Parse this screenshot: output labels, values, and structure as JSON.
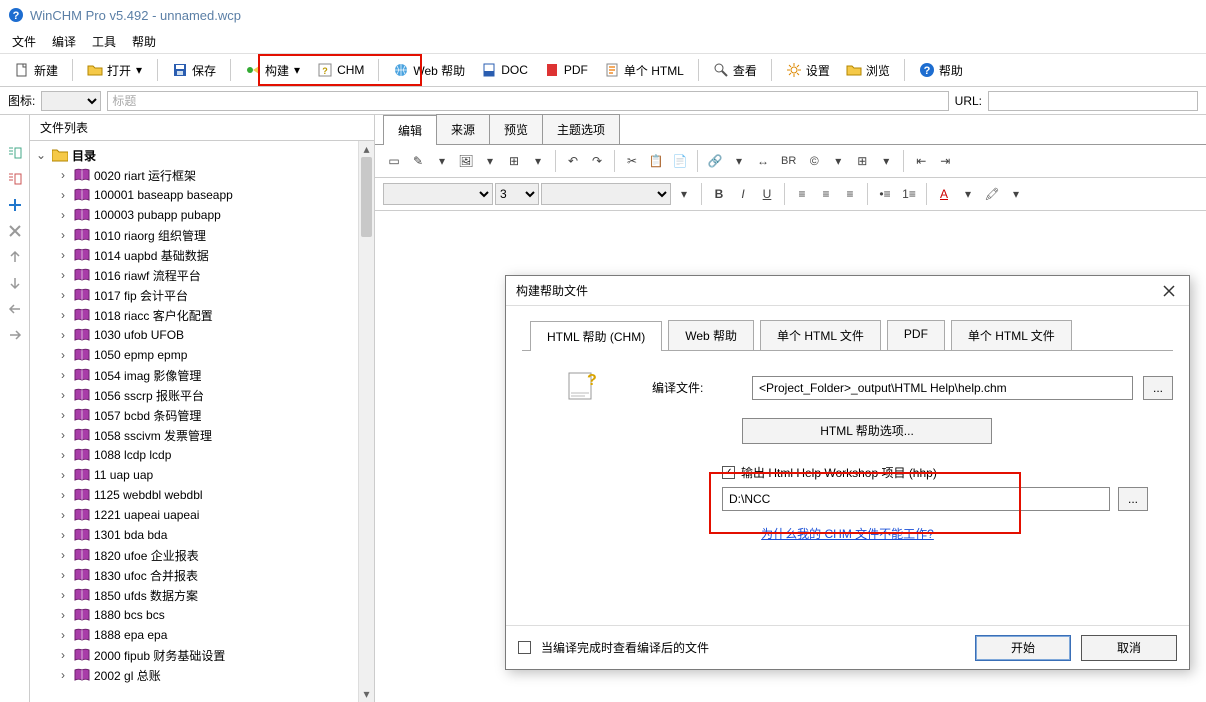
{
  "titlebar": {
    "text": "WinCHM Pro v5.492 - unnamed.wcp"
  },
  "menu": {
    "file": "文件",
    "compile": "编译",
    "tools": "工具",
    "help": "帮助"
  },
  "toolbar": {
    "new": "新建",
    "open": "打开",
    "save": "保存",
    "build": "构建",
    "chm": "CHM",
    "webhelp": "Web 帮助",
    "doc": "DOC",
    "pdf": "PDF",
    "single_html": "单个 HTML",
    "view": "查看",
    "settings": "设置",
    "browse": "浏览",
    "help": "帮助"
  },
  "subbar": {
    "icon_label": "图标:",
    "title_label": "标题:",
    "title_placeholder": "标题",
    "url_label": "URL:"
  },
  "left": {
    "panel_title": "文件列表",
    "root": "目录",
    "items": [
      "0020 riart 运行框架",
      "100001 baseapp baseapp",
      "100003 pubapp pubapp",
      "1010 riaorg 组织管理",
      "1014 uapbd 基础数据",
      "1016 riawf 流程平台",
      "1017 fip 会计平台",
      "1018 riacc 客户化配置",
      "1030 ufob UFOB",
      "1050 epmp epmp",
      "1054 imag 影像管理",
      "1056 sscrp 报账平台",
      "1057 bcbd 条码管理",
      "1058 sscivm 发票管理",
      "1088 lcdp lcdp",
      "11 uap uap",
      "1125 webdbl webdbl",
      "1221 uapeai uapeai",
      "1301 bda bda",
      "1820 ufoe 企业报表",
      "1830 ufoc 合并报表",
      "1850 ufds 数据方案",
      "1880 bcs bcs",
      "1888 epa epa",
      "2000 fipub 财务基础设置",
      "2002 gl 总账"
    ]
  },
  "editor": {
    "tabs": {
      "edit": "编辑",
      "source": "来源",
      "preview": "预览",
      "topic_opts": "主题选项"
    },
    "font_size": "3",
    "br": "BR"
  },
  "dialog": {
    "title": "构建帮助文件",
    "tabs": {
      "chm": "HTML 帮助 (CHM)",
      "web": "Web 帮助",
      "single1": "单个 HTML 文件",
      "pdf": "PDF",
      "single2": "单个 HTML 文件"
    },
    "compile_label": "编译文件:",
    "compile_value": "<Project_Folder>_output\\HTML Help\\help.chm",
    "browse_btn": "...",
    "options_btn": "HTML 帮助选项...",
    "hhp_check": "输出 Html Help Workshop 项目 (hhp)",
    "hhp_path": "D:\\NCC",
    "why_link": "为什么我的 CHM 文件不能工作?",
    "footer_check": "当编译完成时查看编译后的文件",
    "start": "开始",
    "cancel": "取消"
  }
}
